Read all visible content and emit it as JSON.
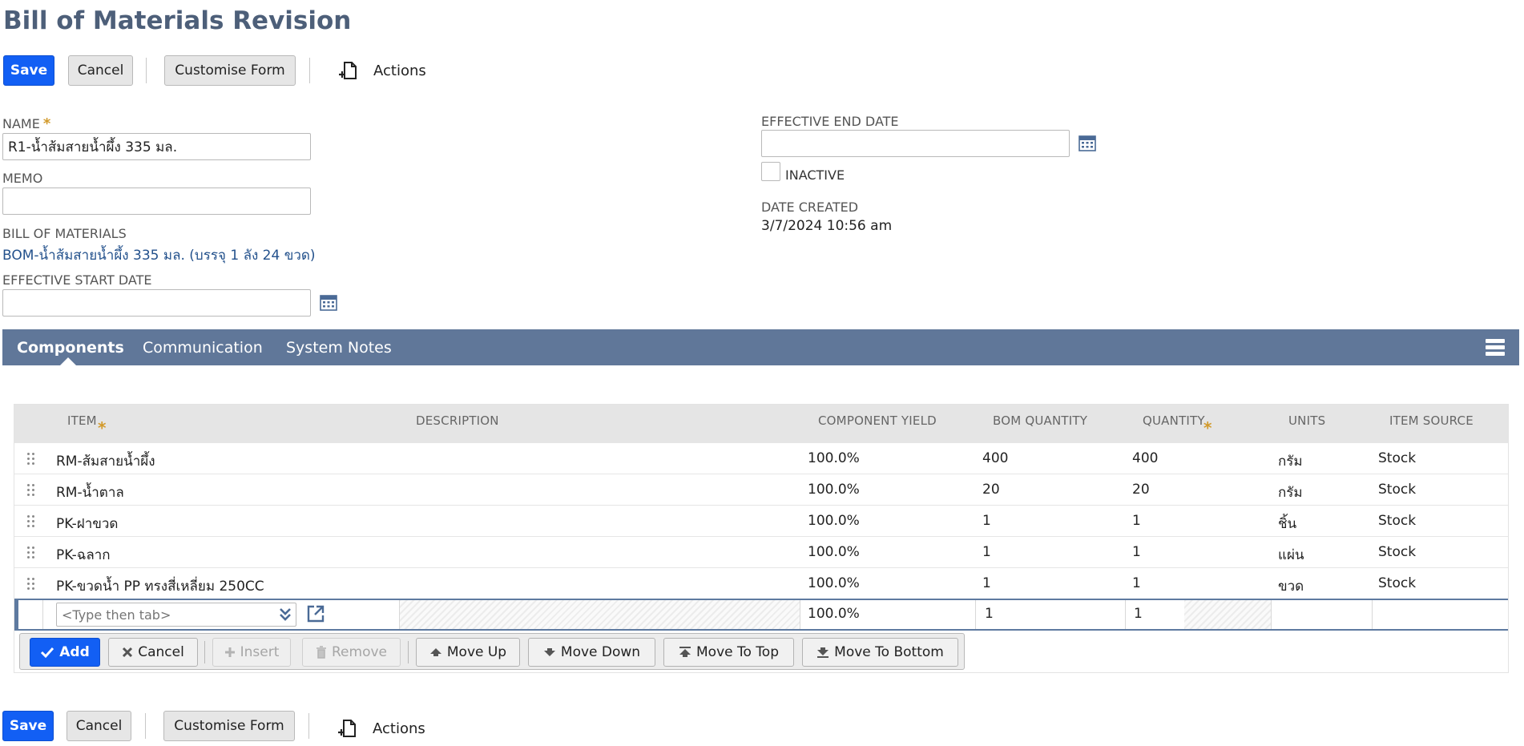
{
  "page": {
    "title": "Bill of Materials Revision"
  },
  "toolbar": {
    "save_label": "Save",
    "cancel_label": "Cancel",
    "customise_label": "Customise Form",
    "actions_label": "Actions"
  },
  "form": {
    "name": {
      "label": "NAME",
      "value": "R1-น้ำส้มสายน้ำผึ้ง 335 มล."
    },
    "memo": {
      "label": "MEMO",
      "value": ""
    },
    "bom": {
      "label": "BILL OF MATERIALS",
      "value": "BOM-น้ำส้มสายน้ำผึ้ง 335 มล. (บรรจุ 1 ลัง 24 ขวด)"
    },
    "start_date": {
      "label": "EFFECTIVE START DATE",
      "value": ""
    },
    "end_date": {
      "label": "EFFECTIVE END DATE",
      "value": ""
    },
    "inactive": {
      "label": "INACTIVE",
      "checked": false
    },
    "date_created": {
      "label": "DATE CREATED",
      "value": "3/7/2024 10:56 am"
    }
  },
  "tabs": [
    {
      "label": "Components",
      "active": true
    },
    {
      "label": "Communication",
      "active": false
    },
    {
      "label": "System Notes",
      "active": false
    }
  ],
  "grid": {
    "columns": [
      "ITEM",
      "DESCRIPTION",
      "COMPONENT YIELD",
      "BOM QUANTITY",
      "QUANTITY",
      "UNITS",
      "ITEM SOURCE"
    ],
    "rows": [
      {
        "item": "RM-ส้มสายน้ำผึ้ง",
        "description": "",
        "yield": "100.0%",
        "bom_qty": "400",
        "qty": "400",
        "units": "กรัม",
        "source": "Stock"
      },
      {
        "item": "RM-น้ำตาล",
        "description": "",
        "yield": "100.0%",
        "bom_qty": "20",
        "qty": "20",
        "units": "กรัม",
        "source": "Stock"
      },
      {
        "item": "PK-ฝาขวด",
        "description": "",
        "yield": "100.0%",
        "bom_qty": "1",
        "qty": "1",
        "units": "ชิ้น",
        "source": "Stock"
      },
      {
        "item": "PK-ฉลาก",
        "description": "",
        "yield": "100.0%",
        "bom_qty": "1",
        "qty": "1",
        "units": "แผ่น",
        "source": "Stock"
      },
      {
        "item": "PK-ขวดน้ำ PP ทรงสี่เหลี่ยม 250CC",
        "description": "",
        "yield": "100.0%",
        "bom_qty": "1",
        "qty": "1",
        "units": "ขวด",
        "source": "Stock"
      }
    ],
    "new_row": {
      "item_placeholder": "<Type then tab>",
      "yield": "100.0%",
      "bom_qty": "1",
      "qty": "1"
    },
    "buttons": {
      "add": "Add",
      "cancel": "Cancel",
      "insert": "Insert",
      "remove": "Remove",
      "move_up": "Move Up",
      "move_down": "Move Down",
      "move_top": "Move To Top",
      "move_bottom": "Move To Bottom"
    }
  },
  "colors": {
    "accent": "#125ff4",
    "tabbar": "#607799",
    "title": "#4d5f79",
    "link": "#23518c"
  },
  "icons": [
    "calendar-icon",
    "new-document-icon",
    "menu-icon",
    "drag-handle-icon",
    "dropdown-icon",
    "open-link-icon",
    "checkmark-icon",
    "x-icon",
    "plus-icon",
    "trash-icon",
    "arrow-up-icon",
    "arrow-down-icon",
    "move-top-icon",
    "move-bottom-icon"
  ]
}
